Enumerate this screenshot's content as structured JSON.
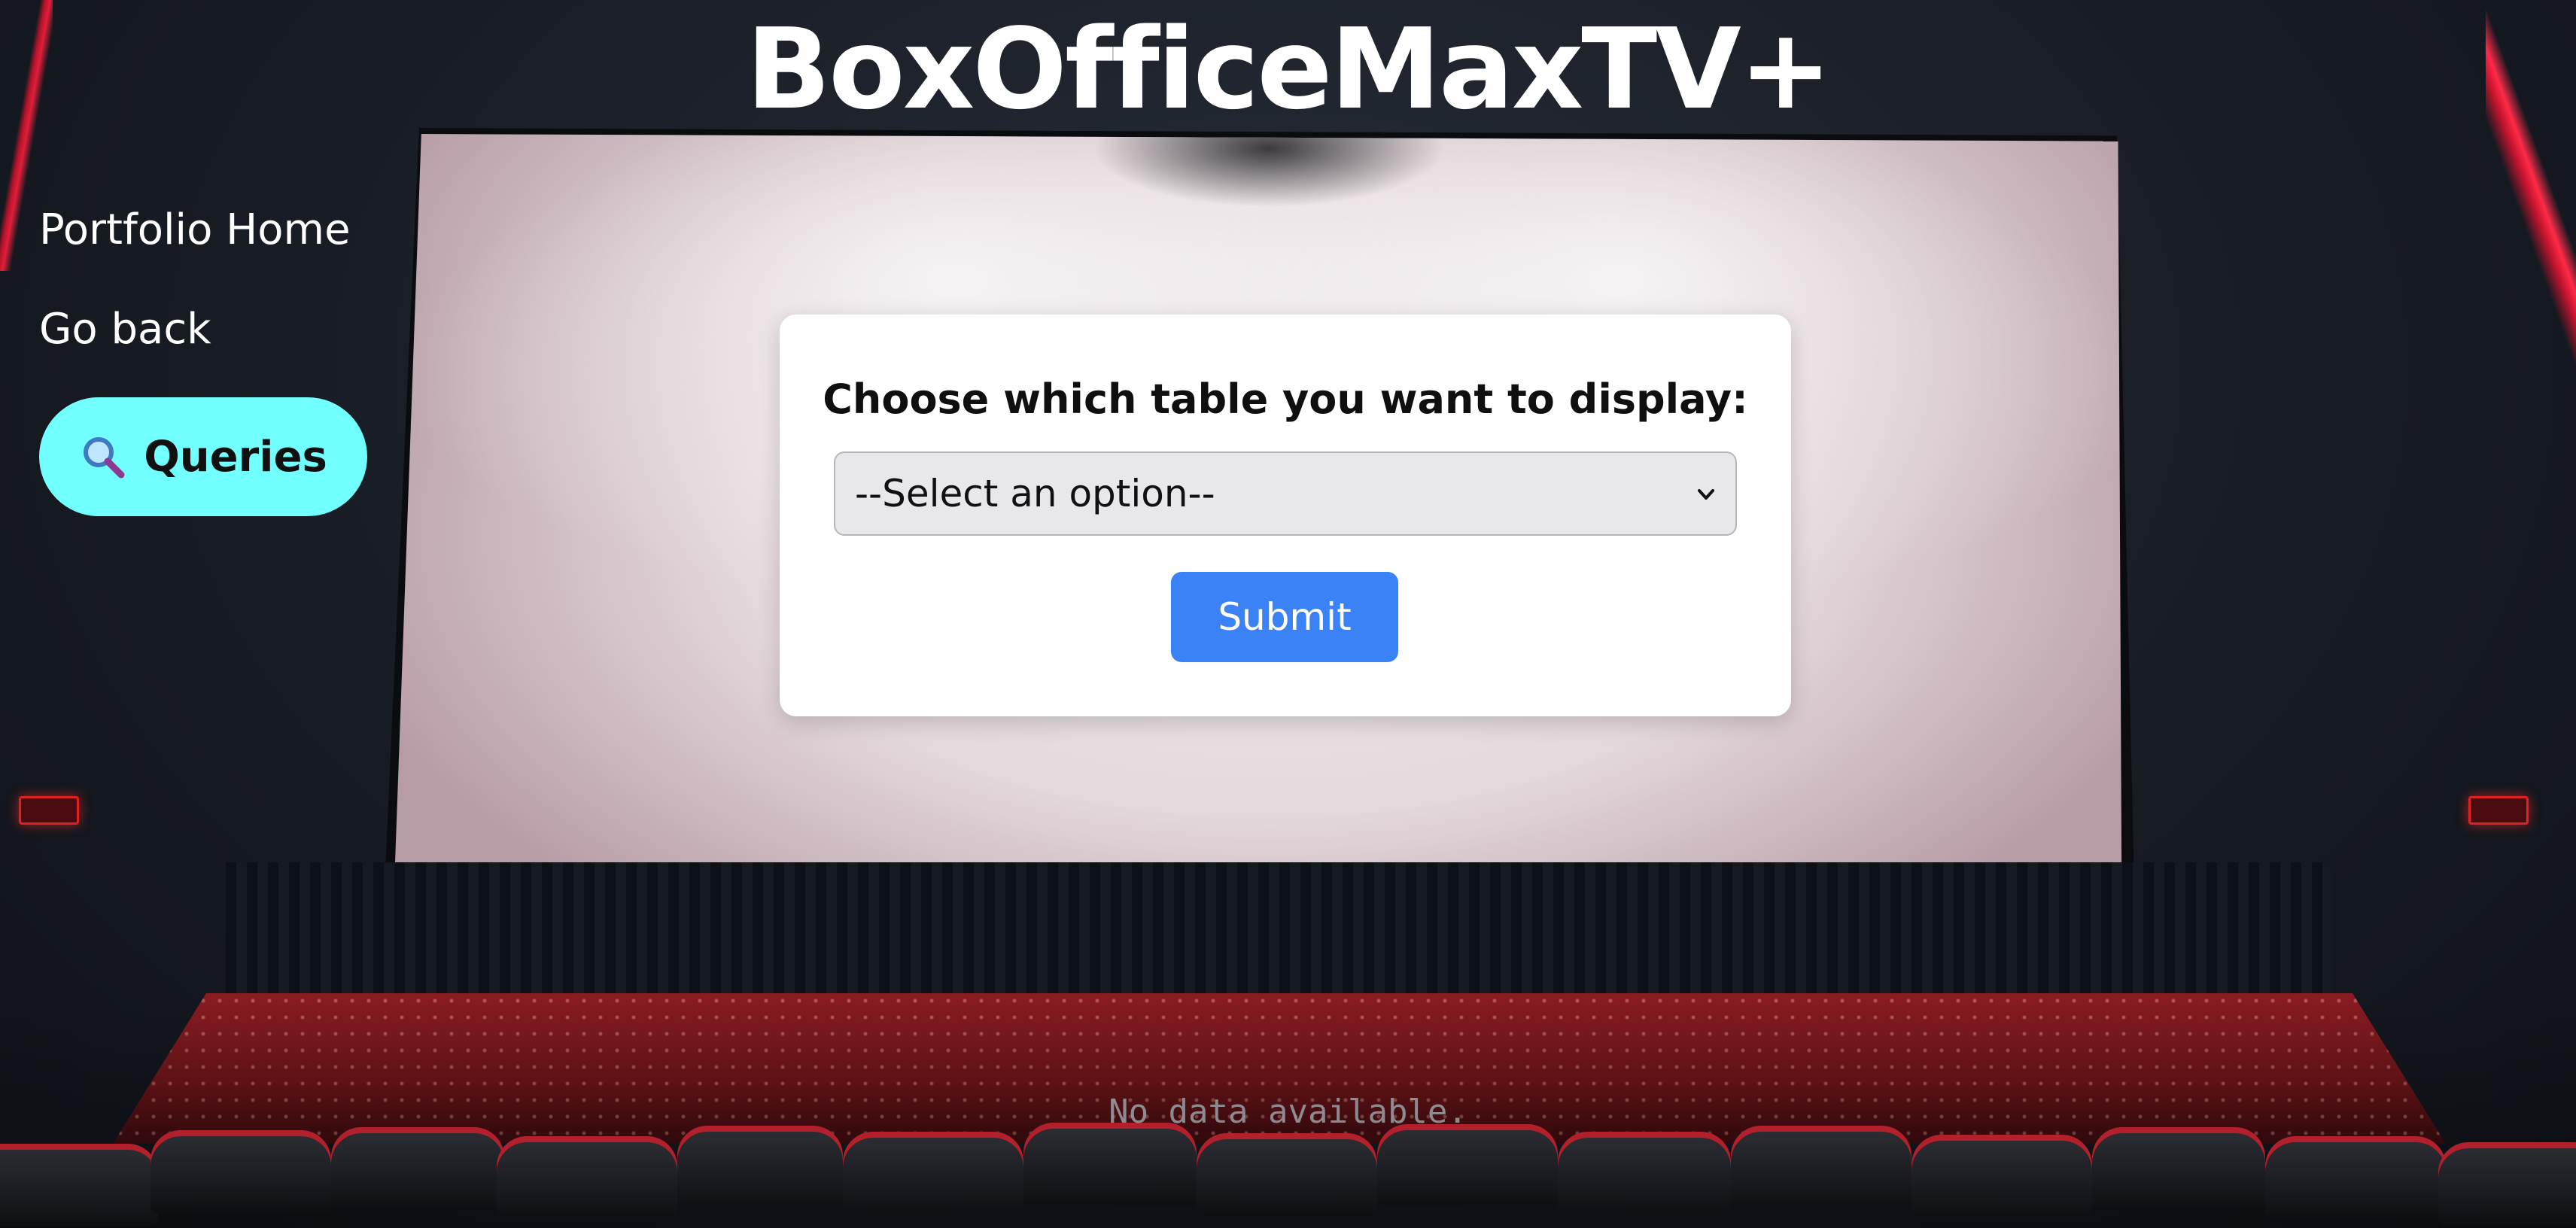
{
  "app": {
    "title": "BoxOfficeMaxTV+"
  },
  "sidebar": {
    "links": [
      {
        "label": "Portfolio Home"
      },
      {
        "label": "Go back"
      }
    ],
    "queries_button": {
      "label": "Queries",
      "icon": "magnifier-icon"
    }
  },
  "form": {
    "heading": "Choose which table you want to display:",
    "select": {
      "selected": "--Select an option--",
      "icon": "chevron-down-icon"
    },
    "submit_label": "Submit"
  },
  "results": {
    "empty_message": "No data available."
  },
  "colors": {
    "queries_button_bg": "#72ffff",
    "submit_bg": "#3b82f6",
    "card_bg": "#ffffff"
  }
}
